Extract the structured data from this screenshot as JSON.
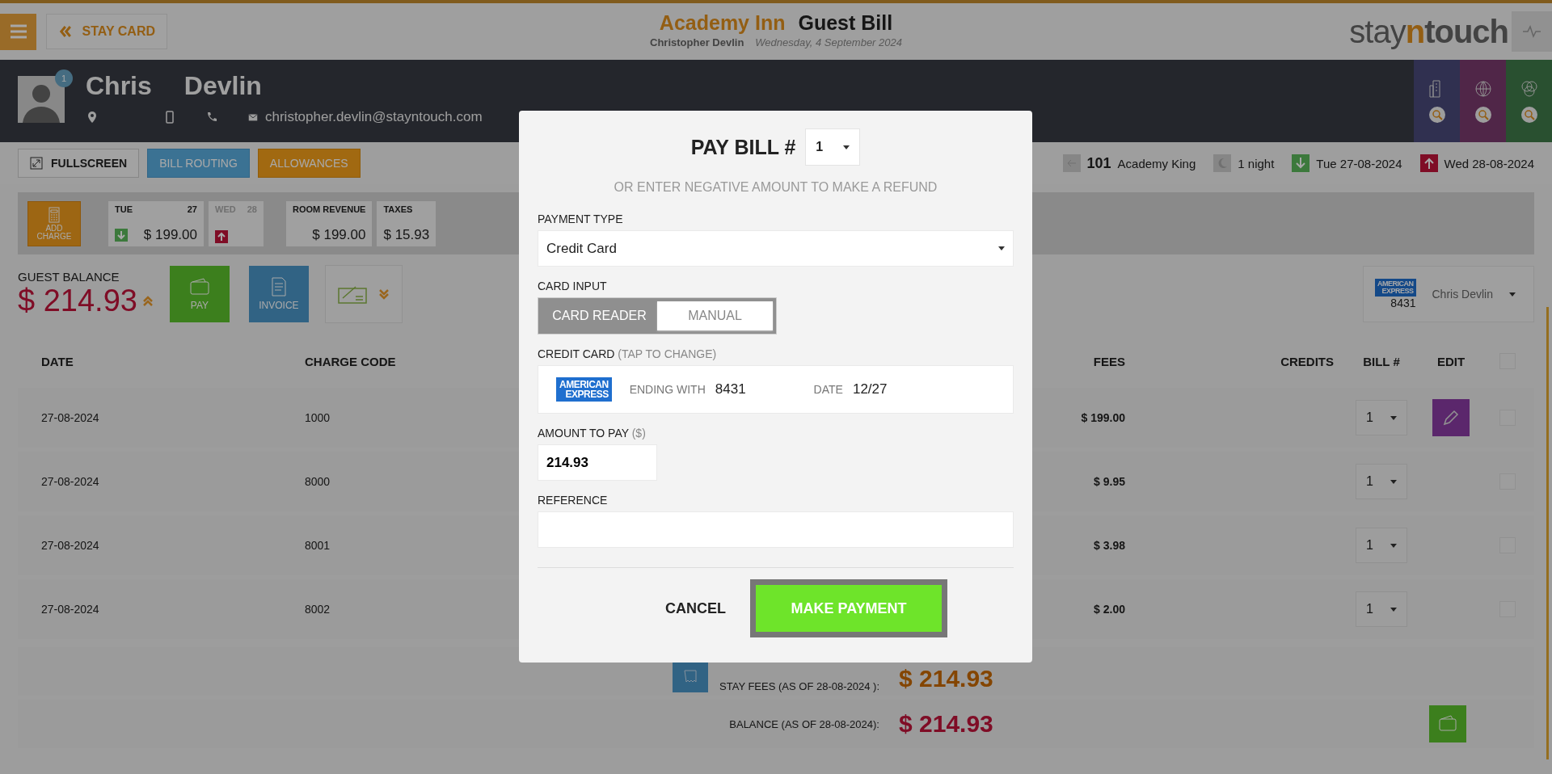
{
  "top_bar": {
    "back_label": "STAY CARD",
    "hotel": "Academy Inn",
    "title": "Guest Bill",
    "guest": "Christopher Devlin",
    "date": "Wednesday, 4 September 2024",
    "logo": {
      "prefix": "stay",
      "accent": "n",
      "suffix": "touch"
    }
  },
  "guest": {
    "first_name": "Chris",
    "last_name": "Devlin",
    "badge": "1",
    "email": "christopher.devlin@stayntouch.com"
  },
  "toolbar": {
    "buttons": [
      {
        "label": "FULLSCREEN",
        "kind": "plain"
      },
      {
        "label": "BILL ROUTING",
        "kind": "blue"
      },
      {
        "label": "ALLOWANCES",
        "kind": "orange"
      }
    ],
    "stay": {
      "room": "101",
      "room_type": "Academy King",
      "nights": "1 night",
      "arrival": "Tue 27-08-2024",
      "departure": "Wed 28-08-2024"
    }
  },
  "stats": {
    "add_charge": "ADD CHARGE",
    "days": [
      {
        "day": "TUE",
        "date": "27",
        "amount": "$ 199.00",
        "kind": "arrival",
        "selected": true
      },
      {
        "day": "WED",
        "date": "28",
        "kind": "departure",
        "selected": false
      }
    ],
    "totals": [
      {
        "label": "ROOM REVENUE",
        "value": "$ 199.00"
      },
      {
        "label": "TAXES",
        "value": "$ 15.93"
      }
    ]
  },
  "balance": {
    "label": "GUEST BALANCE",
    "amount": "$ 214.93",
    "pay": "PAY",
    "invoice": "INVOICE"
  },
  "payer": {
    "brand": [
      "AMERICAN",
      "EXPRESS"
    ],
    "card_ending": "8431",
    "name": "Chris Devlin"
  },
  "table": {
    "columns": [
      "DATE",
      "CHARGE CODE",
      "FEES",
      "CREDITS",
      "BILL #",
      "EDIT"
    ],
    "all_checked": false,
    "rows": [
      {
        "date": "27-08-2024",
        "code": "1000",
        "fees": "$ 199.00",
        "bill": "1",
        "editable": true,
        "checked": false
      },
      {
        "date": "27-08-2024",
        "code": "8000",
        "fees": "$ 9.95",
        "bill": "1",
        "editable": false,
        "checked": false
      },
      {
        "date": "27-08-2024",
        "code": "8001",
        "fees": "$ 3.98",
        "bill": "1",
        "editable": false,
        "checked": false
      },
      {
        "date": "27-08-2024",
        "code": "8002",
        "fees": "$ 2.00",
        "bill": "1",
        "editable": false,
        "checked": false
      }
    ]
  },
  "summary": [
    {
      "kind": "stay_fees",
      "label": "STAY FEES (AS OF  28-08-2024 ):",
      "amount": "$ 214.93"
    },
    {
      "kind": "balance",
      "label": "BALANCE (AS OF  28-08-2024):",
      "amount": "$ 214.93"
    }
  ],
  "modal": {
    "title": "PAY BILL #",
    "bill": "1",
    "hint": "OR ENTER NEGATIVE AMOUNT TO MAKE A REFUND",
    "payment_type": {
      "label": "PAYMENT TYPE",
      "value": "Credit Card"
    },
    "card_input": {
      "label": "CARD INPUT",
      "options": [
        {
          "label": "CARD READER",
          "selected": false
        },
        {
          "label": "MANUAL",
          "selected": true
        }
      ]
    },
    "credit_card": {
      "label": "CREDIT CARD",
      "hint": "(TAP TO CHANGE)",
      "brand": [
        "AMERICAN",
        "EXPRESS"
      ],
      "ending_label": "ENDING WITH",
      "ending": "8431",
      "date_label": "DATE",
      "date": "12/27"
    },
    "amount": {
      "label": "AMOUNT TO PAY",
      "unit": "($)",
      "value": "214.93"
    },
    "reference": {
      "label": "REFERENCE"
    },
    "cancel": "CANCEL",
    "submit": "MAKE PAYMENT"
  }
}
